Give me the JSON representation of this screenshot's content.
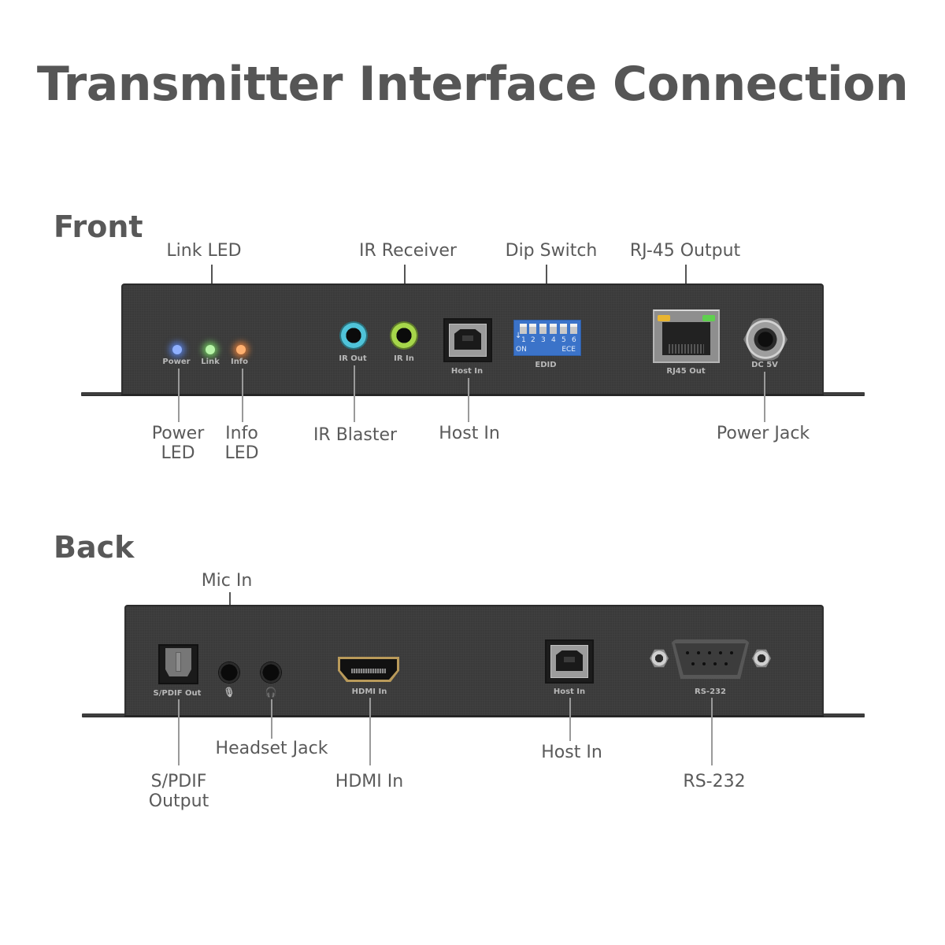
{
  "title": "Transmitter Interface Connection",
  "sections": {
    "front": {
      "heading": "Front",
      "callouts_top": [
        {
          "label": "Link LED"
        },
        {
          "label": "IR Receiver"
        },
        {
          "label": "Dip Switch"
        },
        {
          "label": "RJ-45 Output"
        }
      ],
      "callouts_bottom": [
        {
          "label": "Power\nLED"
        },
        {
          "label": "Info\nLED"
        },
        {
          "label": "IR Blaster"
        },
        {
          "label": "Host In"
        },
        {
          "label": "Power Jack"
        }
      ],
      "panel_labels": {
        "power": "Power",
        "link": "Link",
        "info": "Info",
        "ir_out": "IR Out",
        "ir_in": "IR In",
        "host_in": "Host In",
        "edid": "EDID",
        "rj45_out": "RJ45 Out",
        "dc_5v": "DC 5V"
      },
      "dip_switch": {
        "numbers": [
          "1",
          "2",
          "3",
          "4",
          "5",
          "6"
        ],
        "on_label": "ON",
        "ece_label": "ECE",
        "arrow": "↓"
      },
      "led_colors": {
        "power": "#5b8cff",
        "link": "#7de86a",
        "info": "#ff8a3a"
      },
      "jack_colors": {
        "ir_out": "#4fc3d9",
        "ir_in": "#a6d64a"
      }
    },
    "back": {
      "heading": "Back",
      "callouts_top": [
        {
          "label": "Mic In"
        }
      ],
      "callouts_bottom": [
        {
          "label": "S/PDIF\nOutput"
        },
        {
          "label": "Headset Jack"
        },
        {
          "label": "HDMI In"
        },
        {
          "label": "Host In"
        },
        {
          "label": "RS-232"
        }
      ],
      "panel_labels": {
        "spdif_out": "S/PDIF Out",
        "mic_icon": "🎙",
        "headset_icon": "🎧",
        "hdmi_in": "HDMI In",
        "host_in": "Host In",
        "rs232": "RS-232"
      }
    }
  },
  "colors": {
    "panel": "#3a3a3a",
    "text": "#555555",
    "dip_blue": "#3b73c9"
  }
}
